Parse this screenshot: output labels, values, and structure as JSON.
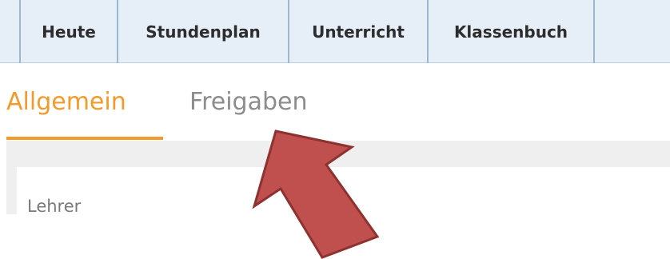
{
  "topnav": {
    "items": [
      {
        "label": "Heute"
      },
      {
        "label": "Stundenplan"
      },
      {
        "label": "Unterricht"
      },
      {
        "label": "Klassenbuch"
      }
    ]
  },
  "subtabs": {
    "items": [
      {
        "label": "Allgemein",
        "active": true
      },
      {
        "label": "Freigaben",
        "active": false
      }
    ]
  },
  "form": {
    "first_label": "Lehrer"
  },
  "colors": {
    "accent": "#f39a2b",
    "nav_bg": "#e6eff7",
    "arrow": "#c0504d"
  },
  "annotation": {
    "icon": "red-arrow-pointing-up-left"
  }
}
